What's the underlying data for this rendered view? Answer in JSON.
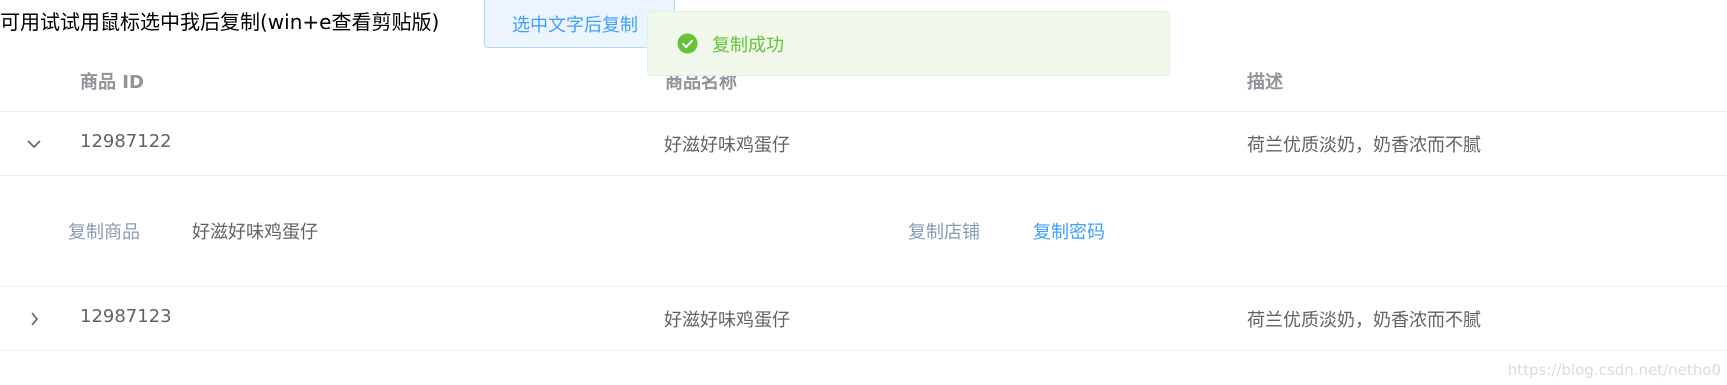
{
  "instruction_text": "可用试试用鼠标选中我后复制(win+e查看剪贴版)",
  "copy_button_label": "选中文字后复制",
  "toast": {
    "message": "复制成功",
    "icon": "check-circle-icon",
    "color": "#67c23a"
  },
  "table": {
    "headers": [
      "商品 ID",
      "商品名称",
      "描述"
    ],
    "rows": [
      {
        "id": "12987122",
        "name": "好滋好味鸡蛋仔",
        "desc": "荷兰优质淡奶，奶香浓而不腻",
        "expanded": true
      },
      {
        "id": "12987123",
        "name": "好滋好味鸡蛋仔",
        "desc": "荷兰优质淡奶，奶香浓而不腻",
        "expanded": false
      }
    ],
    "expanded_row": {
      "copy_product_label": "复制商品",
      "product_name": "好滋好味鸡蛋仔",
      "copy_store_label": "复制店铺",
      "copy_password_label": "复制密码"
    }
  },
  "watermark": "https://blog.csdn.net/netho0"
}
